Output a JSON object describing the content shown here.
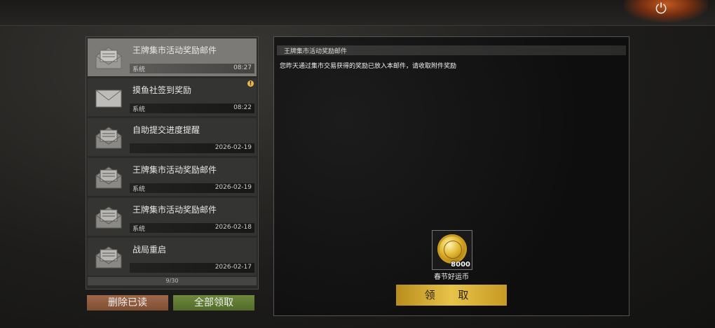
{
  "topbar": {
    "power_icon": "power-icon"
  },
  "mail_list": {
    "items": [
      {
        "title": "王牌集市活动奖励邮件",
        "sender": "系统",
        "time": "08:27",
        "icon": "envelope-open-icon",
        "selected": true
      },
      {
        "title": "摸鱼社签到奖励",
        "sender": "系统",
        "time": "08:22",
        "icon": "envelope-closed-icon",
        "alert": "!"
      },
      {
        "title": "自助提交进度提醒",
        "sender": "",
        "time": "2026-02-19",
        "icon": "envelope-open-icon"
      },
      {
        "title": "王牌集市活动奖励邮件",
        "sender": "系统",
        "time": "2026-02-19",
        "icon": "envelope-open-icon"
      },
      {
        "title": "王牌集市活动奖励邮件",
        "sender": "系统",
        "time": "2026-02-18",
        "icon": "envelope-open-icon"
      },
      {
        "title": "战局重启",
        "sender": "",
        "time": "2026-02-17",
        "icon": "envelope-open-icon"
      }
    ],
    "pager": "9/30"
  },
  "buttons": {
    "delete_read": "删除已读",
    "claim_all": "全部领取"
  },
  "detail": {
    "title": "王牌集市活动奖励邮件",
    "body": "您昨天通过集市交易获得的奖励已放入本邮件，请收取附件奖励",
    "reward": {
      "count": "8000",
      "name": "春节好运币"
    },
    "claim_label": "领 取"
  }
}
